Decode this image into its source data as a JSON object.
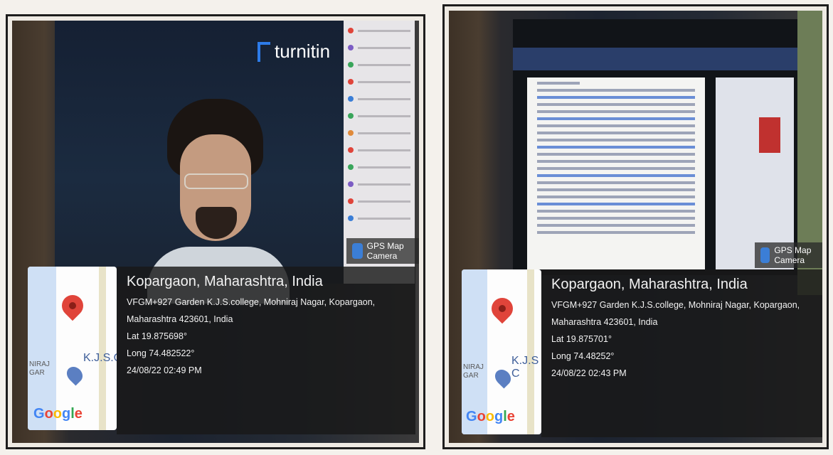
{
  "left_photo": {
    "app_label": "turnitin",
    "gps_camera_label": "GPS Map Camera",
    "map": {
      "area_label": "NIRAJ\nGAR",
      "poi_label": "K.J.S.C",
      "brand": "Google"
    },
    "location": {
      "title": "Kopargaon, Maharashtra, India",
      "address_line1": "VFGM+927 Garden K.J.S.college, Mohniraj Nagar, Kopargaon,",
      "address_line2": "Maharashtra 423601, India",
      "lat": "Lat 19.875698°",
      "long": "Long 74.482522°",
      "timestamp": "24/08/22 02:49 PM"
    }
  },
  "right_photo": {
    "gps_camera_label": "GPS Map Camera",
    "map": {
      "area_label": "NIRAJ\nGAR",
      "poi_label": "K.J.S C",
      "brand": "Google"
    },
    "location": {
      "title": "Kopargaon, Maharashtra, India",
      "address_line1": "VFGM+927 Garden K.J.S.college, Mohniraj Nagar, Kopargaon,",
      "address_line2": "Maharashtra 423601, India",
      "lat": "Lat 19.875701°",
      "long": "Long 74.48252°",
      "timestamp": "24/08/22 02:43 PM"
    }
  },
  "colors": {
    "pin": "#e0443a",
    "turnitin_accent": "#2d7be8",
    "overlay_bg": "#191919"
  }
}
